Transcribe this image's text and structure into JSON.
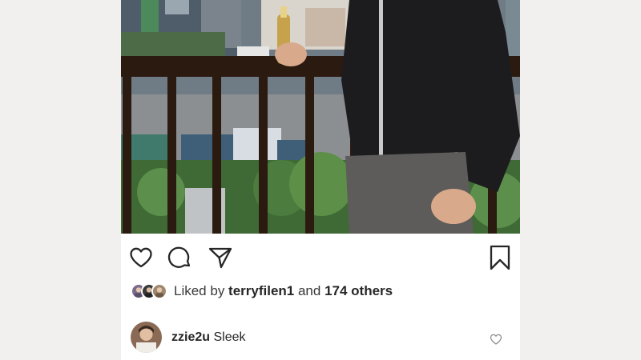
{
  "post": {
    "actions": {
      "like_icon": "heart-outline",
      "comment_icon": "speech-bubble",
      "share_icon": "paper-plane",
      "save_icon": "bookmark-outline"
    },
    "likes": {
      "prefix": "Liked by ",
      "user": "terryfilen1",
      "middle": " and ",
      "others": "174 others"
    },
    "comment": {
      "username": "zzie2u",
      "text": "Sleek",
      "like_icon": "small-heart-outline"
    }
  }
}
